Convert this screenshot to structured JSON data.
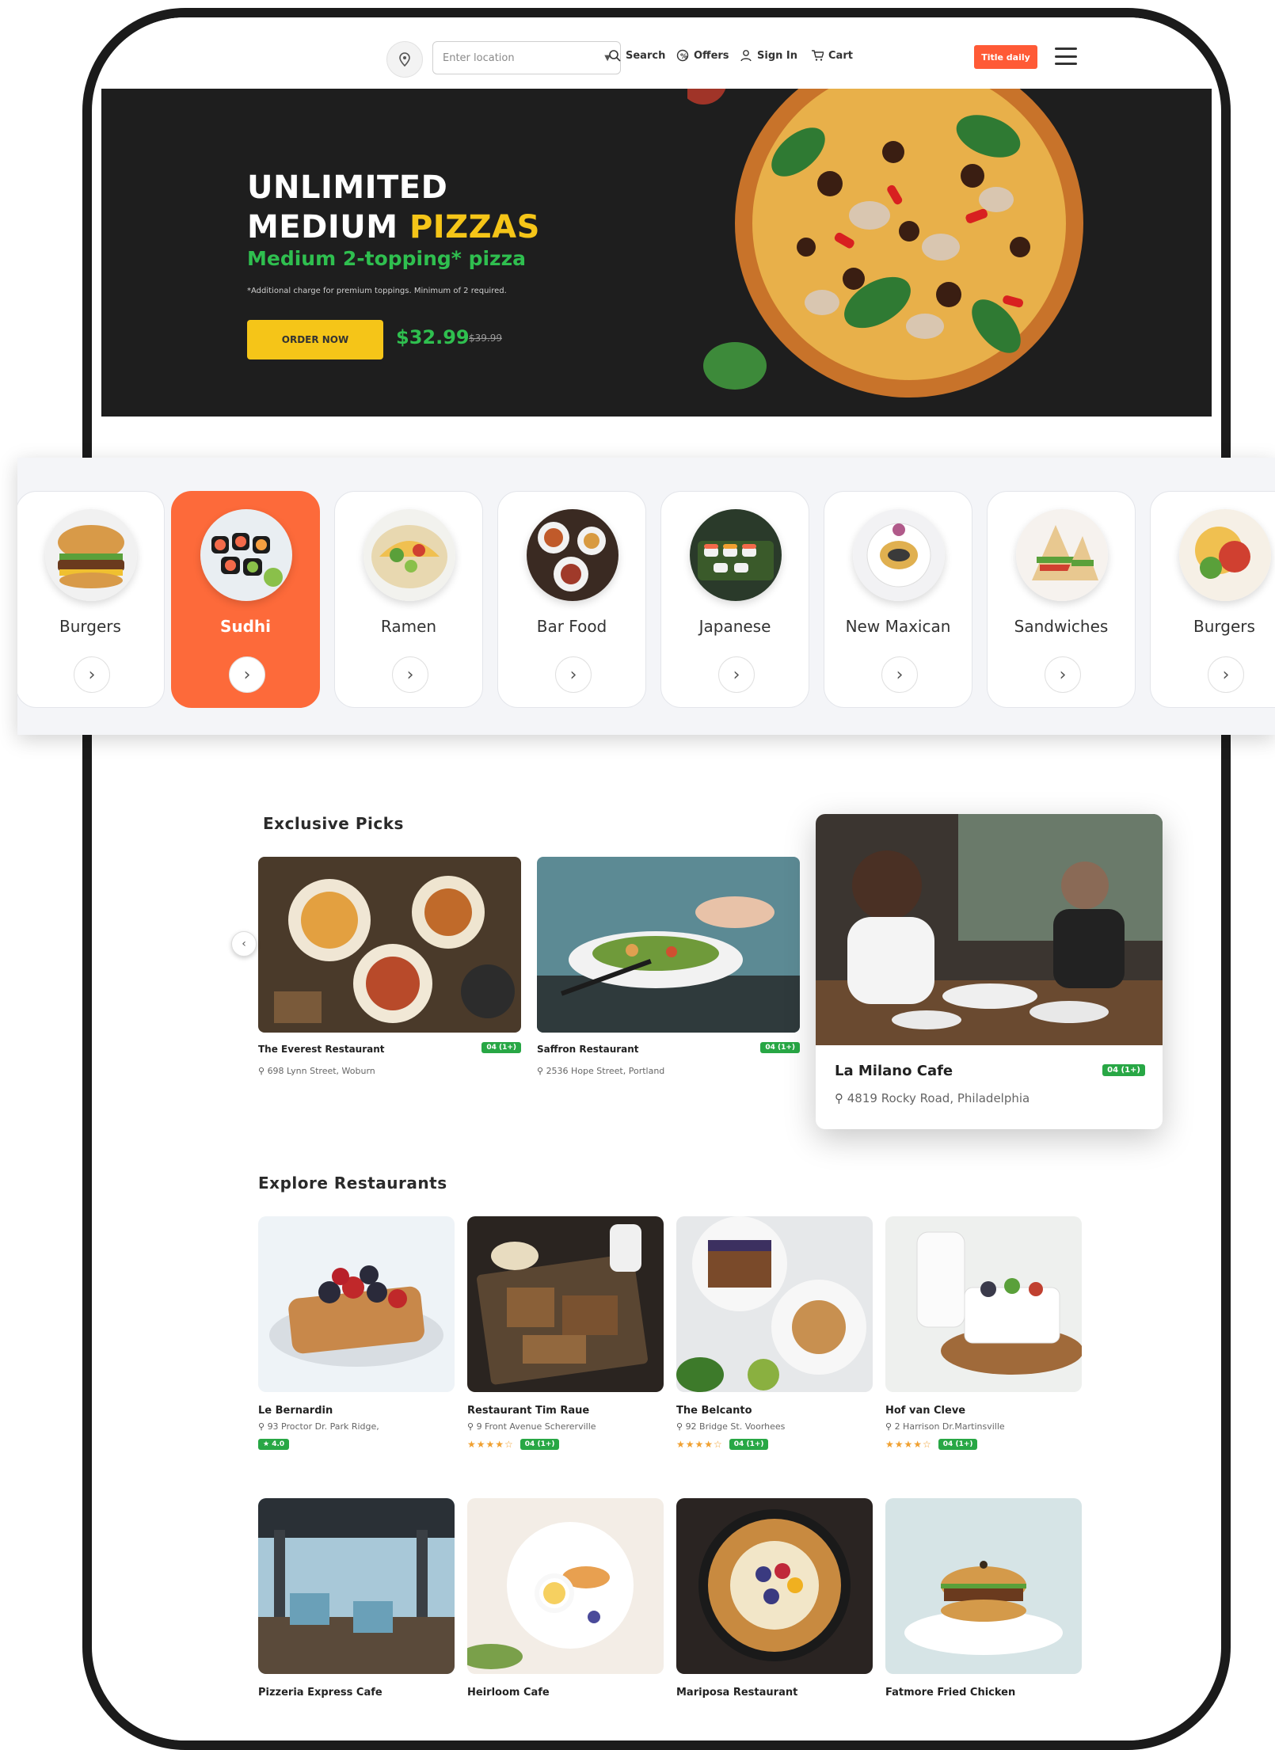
{
  "nav": {
    "location_placeholder": "Enter location",
    "links": [
      "Search",
      "Offers",
      "Sign In",
      "Cart"
    ],
    "trial_button": "Title daily"
  },
  "hero": {
    "title_line1": "UNLIMITED",
    "title_line2_a": "MEDIUM ",
    "title_line2_b": "PIZZAS",
    "subtitle": "Medium 2-topping* pizza",
    "note": "*Additional charge for premium toppings. Minimum of 2 required.",
    "order_label": "ORDER NOW",
    "price": "$32.99",
    "old_price": "$39.99"
  },
  "categories": [
    {
      "label": "Burgers",
      "active": false
    },
    {
      "label": "Sudhi",
      "active": true
    },
    {
      "label": "Ramen",
      "active": false
    },
    {
      "label": "Bar Food",
      "active": false
    },
    {
      "label": "Japanese",
      "active": false
    },
    {
      "label": "New Maxican",
      "active": false
    },
    {
      "label": "Sandwiches",
      "active": false
    },
    {
      "label": "Burgers",
      "active": false
    }
  ],
  "exclusive": {
    "title": "Exclusive Picks",
    "items": [
      {
        "name": "The Everest Restaurant",
        "address": "698 Lynn Street, Woburn",
        "badge": "04 (1+)"
      },
      {
        "name": "Saffron Restaurant",
        "address": "2536 Hope Street, Portland",
        "badge": "04 (1+)"
      }
    ],
    "featured": {
      "name": "La Milano Cafe",
      "address": "4819 Rocky Road, Philadelphia",
      "badge": "04 (1+)"
    }
  },
  "explore": {
    "title": "Explore Restaurants",
    "row1": [
      {
        "name": "Le Bernardin",
        "address": "93 Proctor Dr. Park Ridge,",
        "stars": "",
        "badge": "★ 4.0"
      },
      {
        "name": "Restaurant Tim Raue",
        "address": "9 Front Avenue Schererville",
        "stars": "★★★★☆",
        "badge": "04 (1+)"
      },
      {
        "name": "The Belcanto",
        "address": "92 Bridge St. Voorhees",
        "stars": "★★★★☆",
        "badge": "04 (1+)"
      },
      {
        "name": "Hof van Cleve",
        "address": "2 Harrison Dr.Martinsville",
        "stars": "★★★★☆",
        "badge": "04 (1+)"
      }
    ],
    "row2": [
      {
        "name": "Pizzeria Express Cafe"
      },
      {
        "name": "Heirloom Cafe"
      },
      {
        "name": "Mariposa Restaurant"
      },
      {
        "name": "Fatmore Fried Chicken"
      }
    ]
  }
}
